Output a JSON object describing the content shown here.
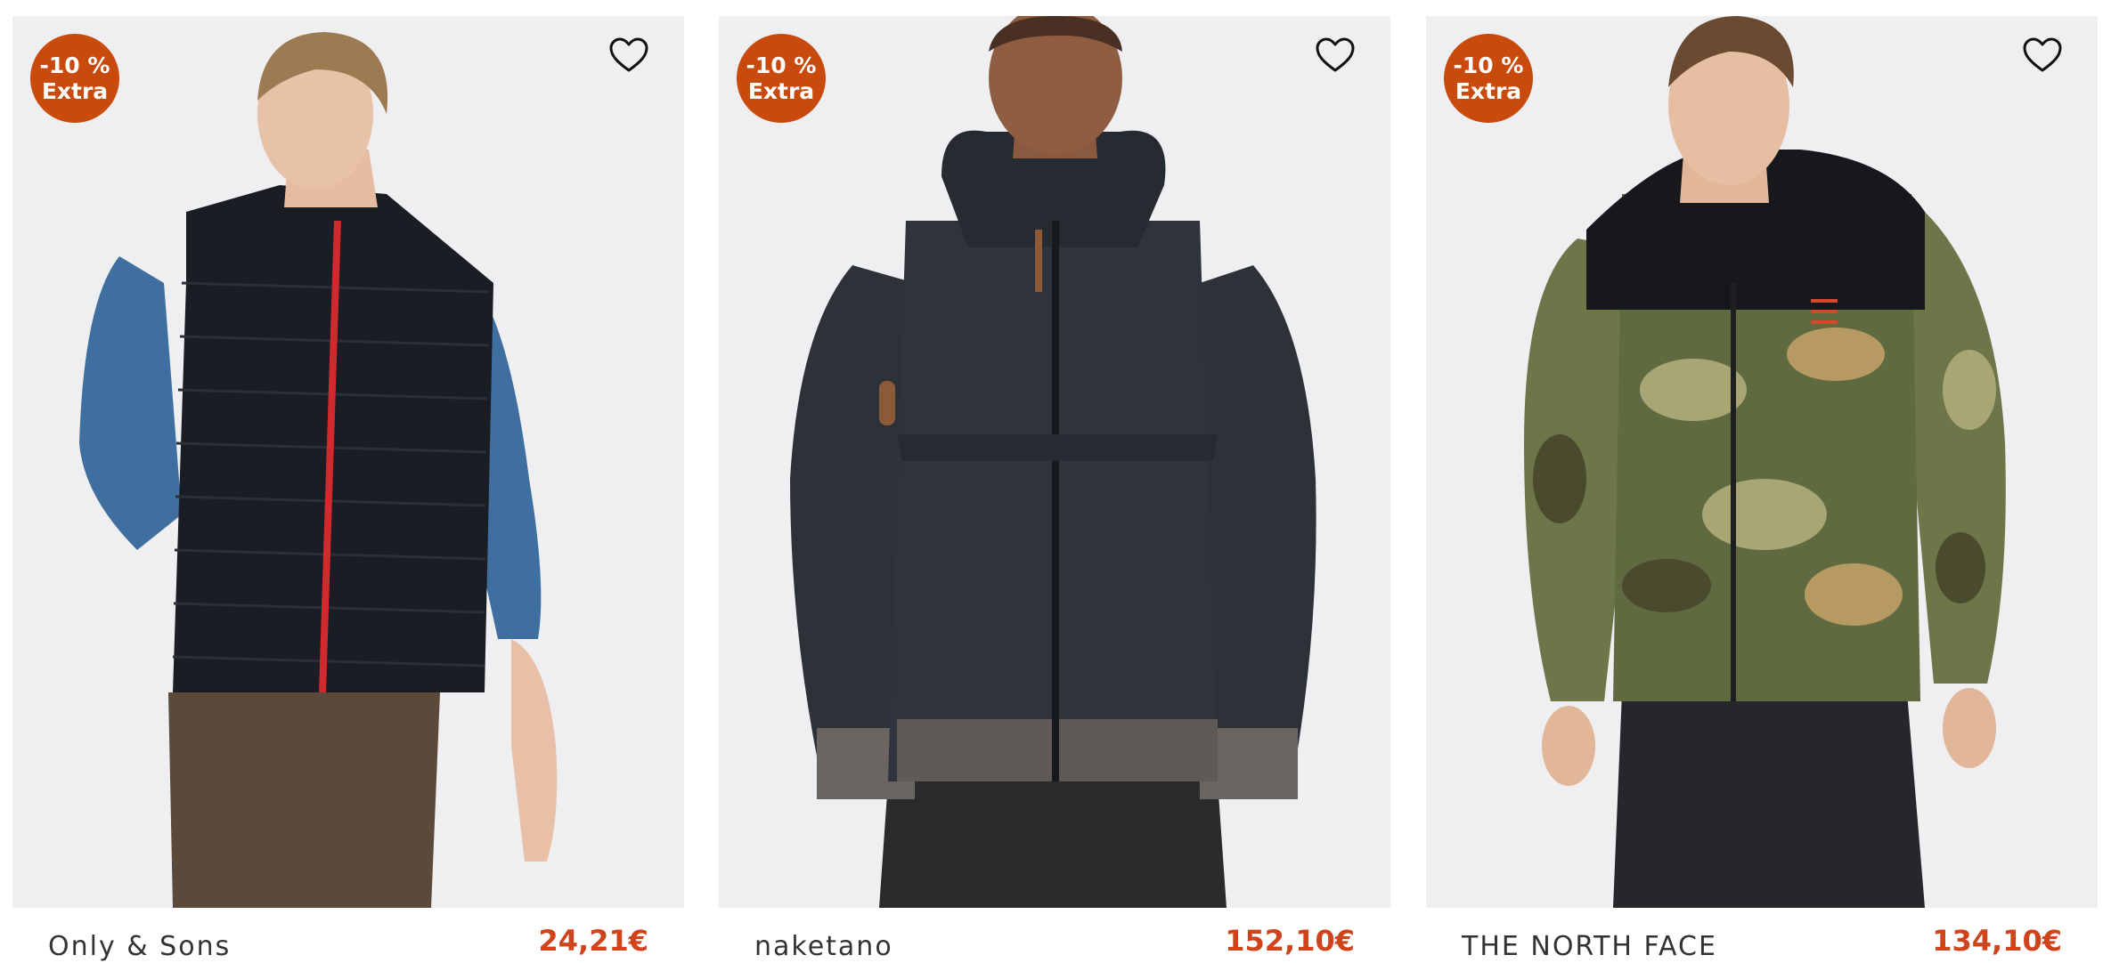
{
  "colors": {
    "badge": "#c84a0d",
    "price": "#d0441c",
    "brand_text": "#333333",
    "photo_bg": "#efeff1"
  },
  "products": [
    {
      "badge_line1": "-10 %",
      "badge_line2": "Extra",
      "brand": "Only & Sons",
      "price": "24,21€",
      "wishlist_icon": "heart-outline-icon"
    },
    {
      "badge_line1": "-10 %",
      "badge_line2": "Extra",
      "brand": "naketano",
      "price": "152,10€",
      "wishlist_icon": "heart-outline-icon"
    },
    {
      "badge_line1": "-10 %",
      "badge_line2": "Extra",
      "brand": "THE NORTH FACE",
      "price": "134,10€",
      "wishlist_icon": "heart-outline-icon"
    }
  ]
}
